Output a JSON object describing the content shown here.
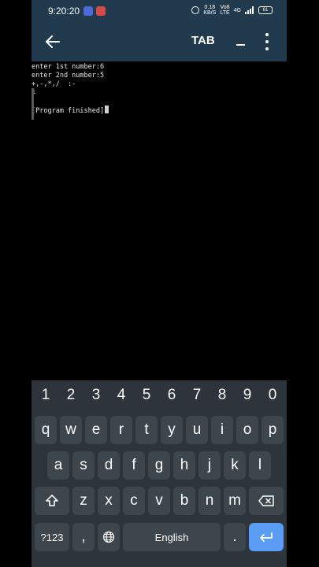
{
  "statusbar": {
    "time": "9:20:20",
    "net_speed": "0.18\nKB/S",
    "volte": "Vo8\nLTE",
    "lte": "4G",
    "battery": "61"
  },
  "appbar": {
    "tab_label": "TAB"
  },
  "terminal": {
    "lines": [
      "enter 1st number:6",
      "enter 2nd number:5",
      "+,-,*,/  :-",
      "1",
      "",
      "[Program finished]"
    ]
  },
  "keyboard": {
    "numbers": [
      "1",
      "2",
      "3",
      "4",
      "5",
      "6",
      "7",
      "8",
      "9",
      "0"
    ],
    "row1": [
      "q",
      "w",
      "e",
      "r",
      "t",
      "y",
      "u",
      "i",
      "o",
      "p"
    ],
    "row2": [
      "a",
      "s",
      "d",
      "f",
      "g",
      "h",
      "j",
      "k",
      "l"
    ],
    "row3": [
      "z",
      "x",
      "c",
      "v",
      "b",
      "n",
      "m"
    ],
    "symbols_label": "?123",
    "comma": ",",
    "space_label": "English",
    "period": "."
  },
  "colors": {
    "appbar": "#213a4d",
    "keyboard_bg": "#2d343b",
    "key_bg": "#3d454d",
    "enter_key": "#5b9cf5"
  }
}
